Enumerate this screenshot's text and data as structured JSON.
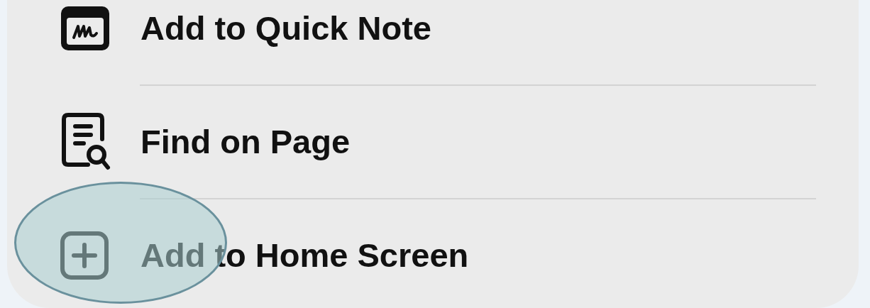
{
  "menu": {
    "items": [
      {
        "label": "Add to Quick Note",
        "kind": "note"
      },
      {
        "label": "Find on Page",
        "kind": "find"
      },
      {
        "label": "Add to Home Screen",
        "kind": "add"
      }
    ]
  }
}
